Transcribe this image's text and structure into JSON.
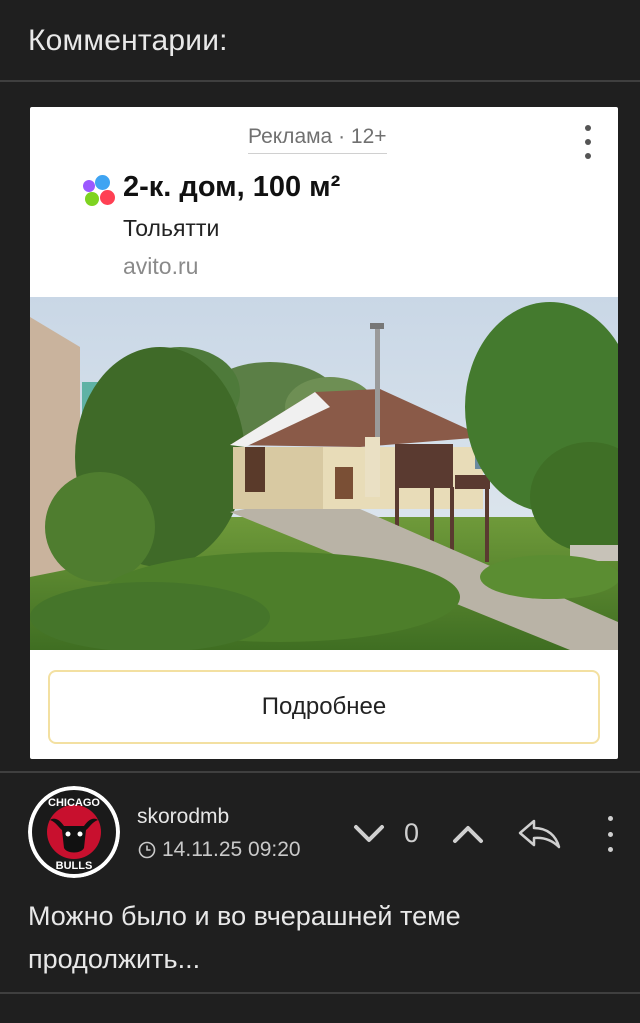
{
  "section": {
    "title": "Комментарии:"
  },
  "ad": {
    "label": "Реклама · 12+",
    "title": "2-к. дом, 100 м²",
    "city": "Тольятти",
    "domain": "avito.ru",
    "button": "Подробнее",
    "image": "house-photo"
  },
  "comment": {
    "username": "skorodmb",
    "datetime": "14.11.25 09:20",
    "votes": "0",
    "text": "Можно было и во вчерашней теме продолжить...",
    "avatar_text_top": "CHICAGO",
    "avatar_text_bottom": "BULLS"
  },
  "colors": {
    "background": "#1f1f1f",
    "divider": "#3f3f3f",
    "button_border": "#f3e0a1",
    "logo_blue": "#3fa4f2",
    "logo_green": "#7ed321",
    "logo_red": "#ff4053",
    "logo_purple": "#9b59ff"
  }
}
